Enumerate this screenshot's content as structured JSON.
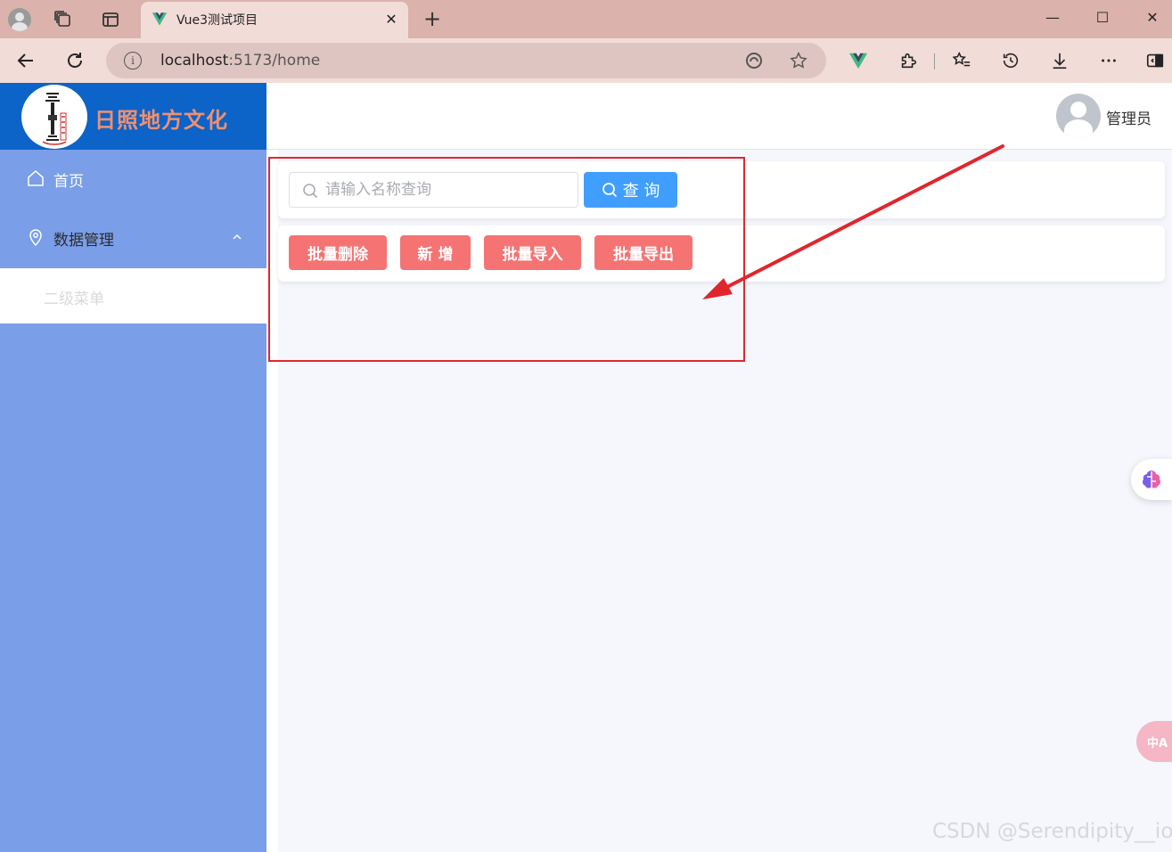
{
  "browser": {
    "tab": {
      "title": "Vue3测试项目",
      "close": "✕"
    },
    "new_tab": "+",
    "window": {
      "minimize": "—",
      "maximize": "☐",
      "close": "✕"
    },
    "address": {
      "host": "localhost",
      "port_path": ":5173/home",
      "info": "i"
    }
  },
  "sidebar": {
    "brand": "日照地方文化",
    "menu": [
      {
        "label": "首页",
        "icon": "home-icon"
      },
      {
        "label": "数据管理",
        "icon": "location-pin-icon",
        "expanded": true
      }
    ],
    "submenu": [
      {
        "label": "二级菜单"
      }
    ]
  },
  "header": {
    "user_name": "管理员"
  },
  "search": {
    "placeholder": "请输入名称查询",
    "value": "",
    "query_label": "查 询"
  },
  "actions": {
    "batch_delete": "批量删除",
    "add": "新 增",
    "batch_import": "批量导入",
    "batch_export": "批量导出"
  },
  "colors": {
    "brand_bg": "#0c63c8",
    "brand_text": "#f0906e",
    "sidebar_bg": "#7a9ee8",
    "primary": "#409eff",
    "danger": "#f56c6c",
    "annotation": "#e0262d"
  },
  "floating": {
    "translate": "中A"
  },
  "watermark": "CSDN @Serendipity__io"
}
